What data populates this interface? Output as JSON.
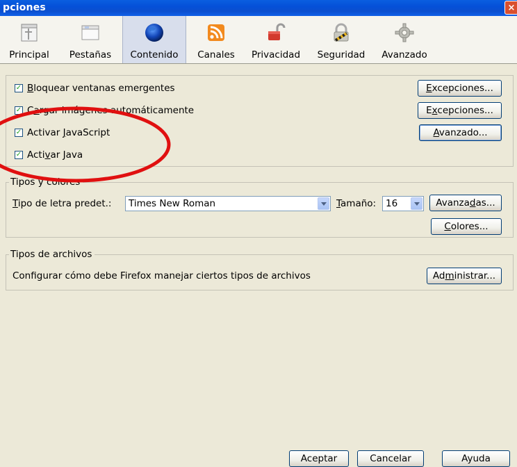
{
  "window": {
    "title": "pciones",
    "close_glyph": "×"
  },
  "toolbar": {
    "items": [
      {
        "label": "Principal",
        "icon": "main-icon"
      },
      {
        "label": "Pestañas",
        "icon": "tabs-icon"
      },
      {
        "label": "Contenido",
        "icon": "globe-icon",
        "selected": true
      },
      {
        "label": "Canales",
        "icon": "feed-icon"
      },
      {
        "label": "Privacidad",
        "icon": "privacy-lock-icon"
      },
      {
        "label": "Seguridad",
        "icon": "security-padlock-icon"
      },
      {
        "label": "Avanzado",
        "icon": "gear-icon"
      }
    ]
  },
  "content_group": {
    "rows": [
      {
        "pre": "",
        "u": "B",
        "post": "loquear ventanas emergentes",
        "checked": true,
        "button": {
          "pre": "",
          "u": "E",
          "post": "xcepciones..."
        }
      },
      {
        "pre": "C",
        "u": "a",
        "post": "rgar imágenes automáticamente",
        "checked": true,
        "button": {
          "pre": "E",
          "u": "x",
          "post": "cepciones..."
        }
      },
      {
        "pre": "Activar ",
        "u": "J",
        "post": "avaScript",
        "checked": true,
        "button": {
          "pre": "",
          "u": "A",
          "post": "vanzado..."
        }
      },
      {
        "pre": "Acti",
        "u": "v",
        "post": "ar Java",
        "checked": true
      }
    ]
  },
  "fonts_group": {
    "legend": "Tipos y colores",
    "font_label": {
      "pre": "",
      "u": "T",
      "post": "ipo de letra predet.:"
    },
    "font_value": "Times New Roman",
    "size_label": {
      "pre": "",
      "u": "T",
      "post": "amaño:"
    },
    "size_value": "16",
    "advanced_button": {
      "pre": "Avanza",
      "u": "d",
      "post": "as..."
    },
    "colors_button": {
      "pre": "",
      "u": "C",
      "post": "olores..."
    }
  },
  "files_group": {
    "legend": "Tipos de archivos",
    "description": "Configurar cómo debe Firefox manejar ciertos tipos de archivos",
    "manage_button": {
      "pre": "Ad",
      "u": "m",
      "post": "inistrar..."
    }
  },
  "footer": {
    "accept": "Aceptar",
    "cancel": "Cancelar",
    "help": "Ayuda"
  },
  "colors": {
    "titlebar": "#0A5FE0",
    "annotation": "#E01010",
    "check": "#21A121"
  }
}
